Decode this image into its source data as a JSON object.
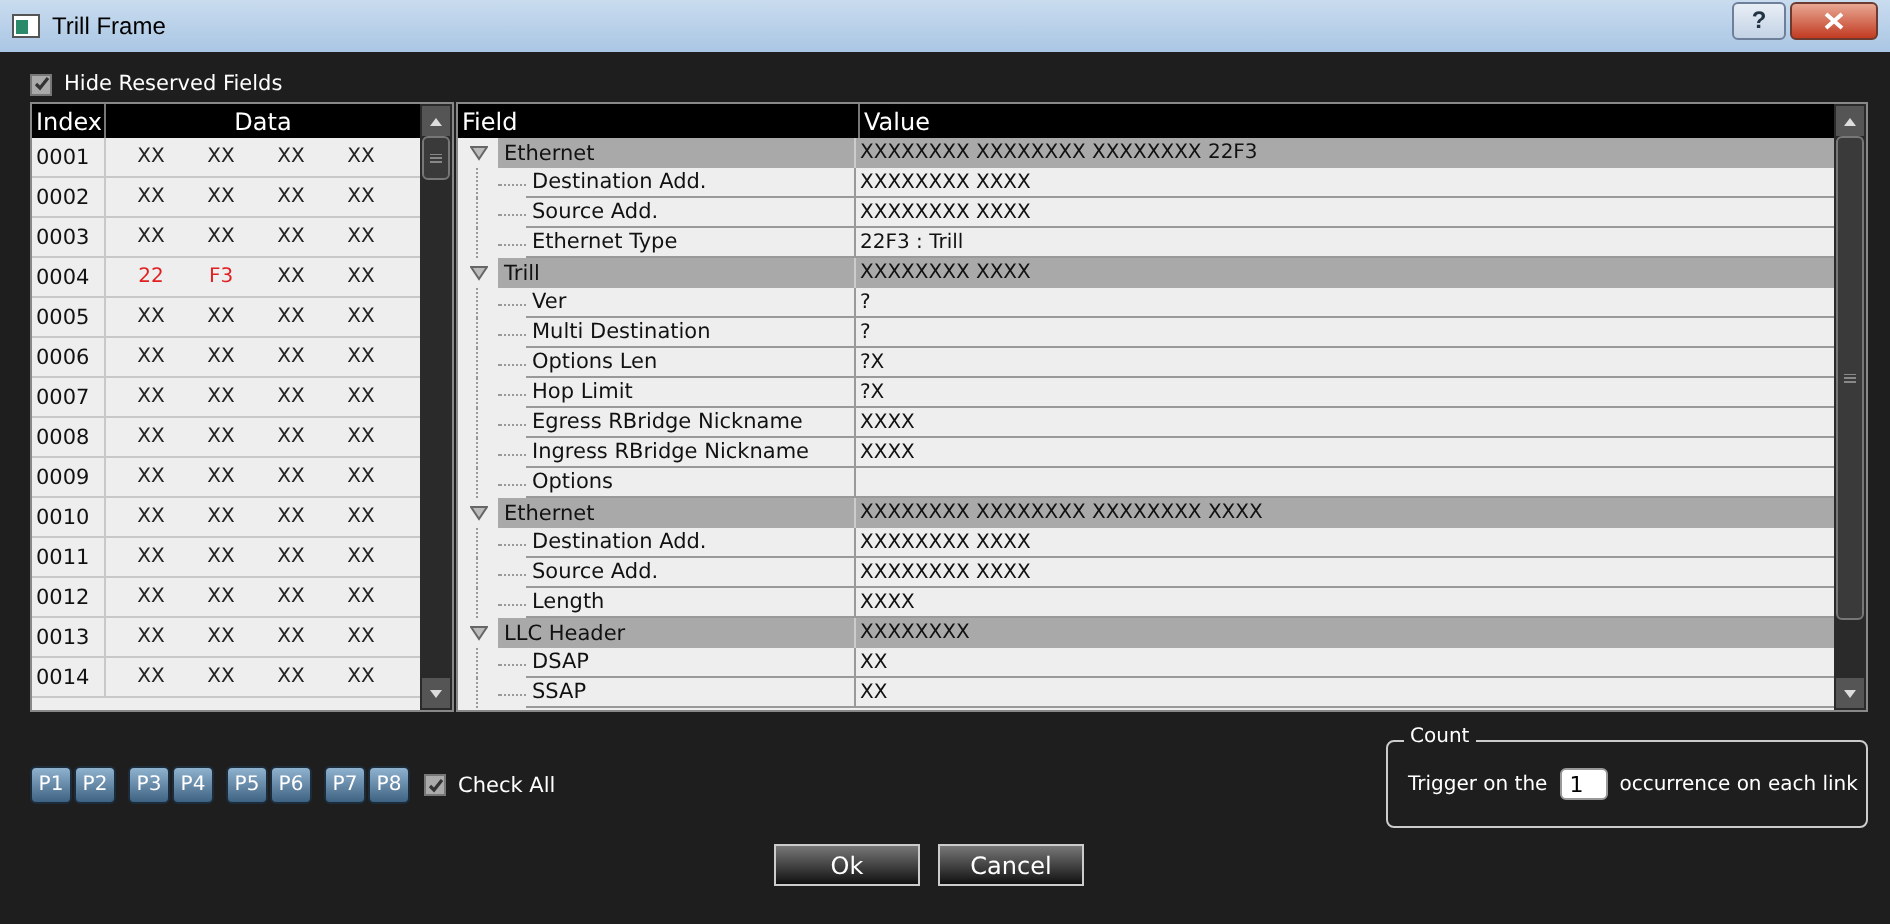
{
  "window": {
    "title": "Trill Frame",
    "help_button": "?"
  },
  "hide_reserved": {
    "label": "Hide Reserved Fields",
    "checked": true
  },
  "hex_table": {
    "columns": [
      "Index",
      "Data"
    ],
    "rows": [
      {
        "index": "0001",
        "cells": [
          {
            "text": "XX",
            "highlighted": false
          },
          {
            "text": "XX",
            "highlighted": false
          },
          {
            "text": "XX",
            "highlighted": false
          },
          {
            "text": "XX",
            "highlighted": false
          }
        ]
      },
      {
        "index": "0002",
        "cells": [
          {
            "text": "XX",
            "highlighted": false
          },
          {
            "text": "XX",
            "highlighted": false
          },
          {
            "text": "XX",
            "highlighted": false
          },
          {
            "text": "XX",
            "highlighted": false
          }
        ]
      },
      {
        "index": "0003",
        "cells": [
          {
            "text": "XX",
            "highlighted": false
          },
          {
            "text": "XX",
            "highlighted": false
          },
          {
            "text": "XX",
            "highlighted": false
          },
          {
            "text": "XX",
            "highlighted": false
          }
        ]
      },
      {
        "index": "0004",
        "cells": [
          {
            "text": "22",
            "highlighted": true
          },
          {
            "text": "F3",
            "highlighted": true
          },
          {
            "text": "XX",
            "highlighted": false
          },
          {
            "text": "XX",
            "highlighted": false
          }
        ]
      },
      {
        "index": "0005",
        "cells": [
          {
            "text": "XX",
            "highlighted": false
          },
          {
            "text": "XX",
            "highlighted": false
          },
          {
            "text": "XX",
            "highlighted": false
          },
          {
            "text": "XX",
            "highlighted": false
          }
        ]
      },
      {
        "index": "0006",
        "cells": [
          {
            "text": "XX",
            "highlighted": false
          },
          {
            "text": "XX",
            "highlighted": false
          },
          {
            "text": "XX",
            "highlighted": false
          },
          {
            "text": "XX",
            "highlighted": false
          }
        ]
      },
      {
        "index": "0007",
        "cells": [
          {
            "text": "XX",
            "highlighted": false
          },
          {
            "text": "XX",
            "highlighted": false
          },
          {
            "text": "XX",
            "highlighted": false
          },
          {
            "text": "XX",
            "highlighted": false
          }
        ]
      },
      {
        "index": "0008",
        "cells": [
          {
            "text": "XX",
            "highlighted": false
          },
          {
            "text": "XX",
            "highlighted": false
          },
          {
            "text": "XX",
            "highlighted": false
          },
          {
            "text": "XX",
            "highlighted": false
          }
        ]
      },
      {
        "index": "0009",
        "cells": [
          {
            "text": "XX",
            "highlighted": false
          },
          {
            "text": "XX",
            "highlighted": false
          },
          {
            "text": "XX",
            "highlighted": false
          },
          {
            "text": "XX",
            "highlighted": false
          }
        ]
      },
      {
        "index": "0010",
        "cells": [
          {
            "text": "XX",
            "highlighted": false
          },
          {
            "text": "XX",
            "highlighted": false
          },
          {
            "text": "XX",
            "highlighted": false
          },
          {
            "text": "XX",
            "highlighted": false
          }
        ]
      },
      {
        "index": "0011",
        "cells": [
          {
            "text": "XX",
            "highlighted": false
          },
          {
            "text": "XX",
            "highlighted": false
          },
          {
            "text": "XX",
            "highlighted": false
          },
          {
            "text": "XX",
            "highlighted": false
          }
        ]
      },
      {
        "index": "0012",
        "cells": [
          {
            "text": "XX",
            "highlighted": false
          },
          {
            "text": "XX",
            "highlighted": false
          },
          {
            "text": "XX",
            "highlighted": false
          },
          {
            "text": "XX",
            "highlighted": false
          }
        ]
      },
      {
        "index": "0013",
        "cells": [
          {
            "text": "XX",
            "highlighted": false
          },
          {
            "text": "XX",
            "highlighted": false
          },
          {
            "text": "XX",
            "highlighted": false
          },
          {
            "text": "XX",
            "highlighted": false
          }
        ]
      },
      {
        "index": "0014",
        "cells": [
          {
            "text": "XX",
            "highlighted": false
          },
          {
            "text": "XX",
            "highlighted": false
          },
          {
            "text": "XX",
            "highlighted": false
          },
          {
            "text": "XX",
            "highlighted": false
          }
        ]
      }
    ]
  },
  "field_tree": {
    "columns": [
      "Field",
      "Value"
    ],
    "groups": [
      {
        "name": "Ethernet",
        "value": "XXXXXXXX XXXXXXXX XXXXXXXX 22F3",
        "expanded": true,
        "children": [
          {
            "name": "Destination Add.",
            "value": "XXXXXXXX XXXX"
          },
          {
            "name": "Source Add.",
            "value": "XXXXXXXX XXXX"
          },
          {
            "name": "Ethernet Type",
            "value": "22F3 : Trill"
          }
        ]
      },
      {
        "name": "Trill",
        "value": "XXXXXXXX XXXX",
        "expanded": true,
        "children": [
          {
            "name": "Ver",
            "value": "?"
          },
          {
            "name": "Multi Destination",
            "value": "?"
          },
          {
            "name": "Options Len",
            "value": "?X"
          },
          {
            "name": "Hop Limit",
            "value": "?X"
          },
          {
            "name": "Egress RBridge Nickname",
            "value": "XXXX"
          },
          {
            "name": "Ingress RBridge Nickname",
            "value": "XXXX"
          },
          {
            "name": "Options"
          }
        ]
      },
      {
        "name": "Ethernet",
        "value": "XXXXXXXX XXXXXXXX XXXXXXXX XXXX",
        "expanded": true,
        "children": [
          {
            "name": "Destination Add.",
            "value": "XXXXXXXX XXXX"
          },
          {
            "name": "Source Add.",
            "value": "XXXXXXXX XXXX"
          },
          {
            "name": "Length",
            "value": "XXXX"
          }
        ]
      },
      {
        "name": "LLC Header",
        "value": "XXXXXXXX",
        "expanded": true,
        "children": [
          {
            "name": "DSAP",
            "value": "XX"
          },
          {
            "name": "SSAP",
            "value": "XX"
          }
        ]
      }
    ]
  },
  "port_buttons": [
    {
      "label": "P1"
    },
    {
      "label": "P2"
    },
    {
      "label": "P3"
    },
    {
      "label": "P4"
    },
    {
      "label": "P5"
    },
    {
      "label": "P6"
    },
    {
      "label": "P7"
    },
    {
      "label": "P8"
    }
  ],
  "check_all": {
    "label": "Check All",
    "checked": true
  },
  "count": {
    "title": "Count",
    "prefix": "Trigger on the",
    "value": "1",
    "suffix": "occurrence on each link"
  },
  "buttons": [
    "Ok",
    "Cancel"
  ]
}
